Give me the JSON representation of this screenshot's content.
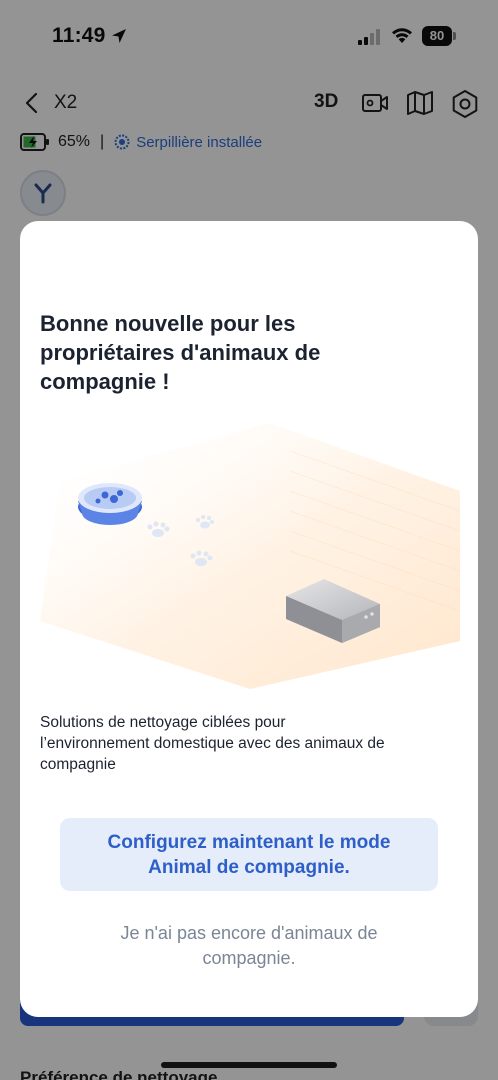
{
  "status_bar": {
    "time": "11:49",
    "battery_level": "80",
    "icons": [
      "location-arrow-icon",
      "cellular-signal-icon",
      "wifi-icon",
      "battery-icon"
    ]
  },
  "header": {
    "back_icon": "chevron-left-icon",
    "device_name": "X2",
    "view_3d_label": "3D",
    "icons": [
      "video-camera-icon",
      "map-icon",
      "gear-icon"
    ]
  },
  "device_status": {
    "battery_percent": "65%",
    "separator": "|",
    "mop_status": "Serpillière installée"
  },
  "background": {
    "bottom_section_label": "Préférence de nettoyage"
  },
  "modal": {
    "title": "Bonne nouvelle pour les\npropriétaires d'animaux de\ncompagnie !",
    "description": "Solutions de nettoyage ciblées pour\nl’environnement domestique avec des animaux de\ncompagnie",
    "primary_button": "Configurez maintenant le mode\nAnimal de compagnie.",
    "secondary_button": "Je n'ai pas encore d'animaux de\ncompagnie."
  },
  "colors": {
    "accent_blue": "#2e5fc9",
    "primary_button_bg": "#e5edfb",
    "secondary_text": "#7a8596",
    "mop_text": "#2f6bd8"
  }
}
